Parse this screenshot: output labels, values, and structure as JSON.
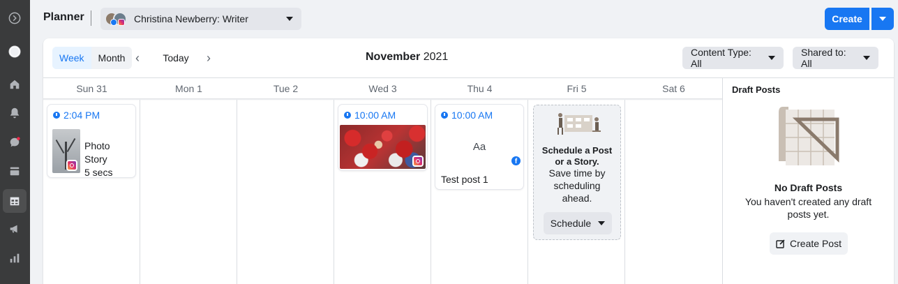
{
  "app": {
    "title": "Planner"
  },
  "sidebar": {
    "items": [
      {
        "icon": "expand-icon"
      },
      {
        "icon": "profile-icon"
      },
      {
        "icon": "home-icon"
      },
      {
        "icon": "bell-icon"
      },
      {
        "icon": "chat-icon"
      },
      {
        "icon": "posts-icon"
      },
      {
        "icon": "planner-icon",
        "active": true
      },
      {
        "icon": "megaphone-icon"
      },
      {
        "icon": "insights-icon"
      }
    ]
  },
  "account": {
    "name": "Christina Newberry: Writer"
  },
  "header": {
    "create_label": "Create"
  },
  "toolbar": {
    "week_label": "Week",
    "month_label": "Month",
    "today_label": "Today",
    "month_name": "November",
    "year": "2021",
    "content_type_label": "Content Type: All",
    "shared_to_label": "Shared to: All"
  },
  "days": [
    "Sun 31",
    "Mon 1",
    "Tue 2",
    "Wed 3",
    "Thu 4",
    "Fri 5",
    "Sat 6"
  ],
  "posts": {
    "sun": {
      "time": "2:04 PM",
      "line1": "Photo Story",
      "line2": "5 secs",
      "platform": "instagram"
    },
    "wed": {
      "time": "10:00 AM",
      "platform": "instagram"
    },
    "thu": {
      "time": "10:00 AM",
      "glyph": "Aa",
      "caption": "Test post 1",
      "platform": "facebook"
    }
  },
  "schedule_prompt": {
    "title_line1": "Schedule a Post",
    "title_line2": "or a Story.",
    "desc_line1": "Save time by",
    "desc_line2": "scheduling",
    "desc_line3": "ahead.",
    "button_label": "Schedule"
  },
  "drafts": {
    "title": "Draft Posts",
    "empty_title": "No Draft Posts",
    "empty_line1": "You haven't created any draft",
    "empty_line2": "posts yet.",
    "create_label": "Create Post"
  },
  "colors": {
    "accent": "#1877f2",
    "sidebar_bg": "#3a3b3c",
    "page_bg": "#f0f2f5"
  }
}
